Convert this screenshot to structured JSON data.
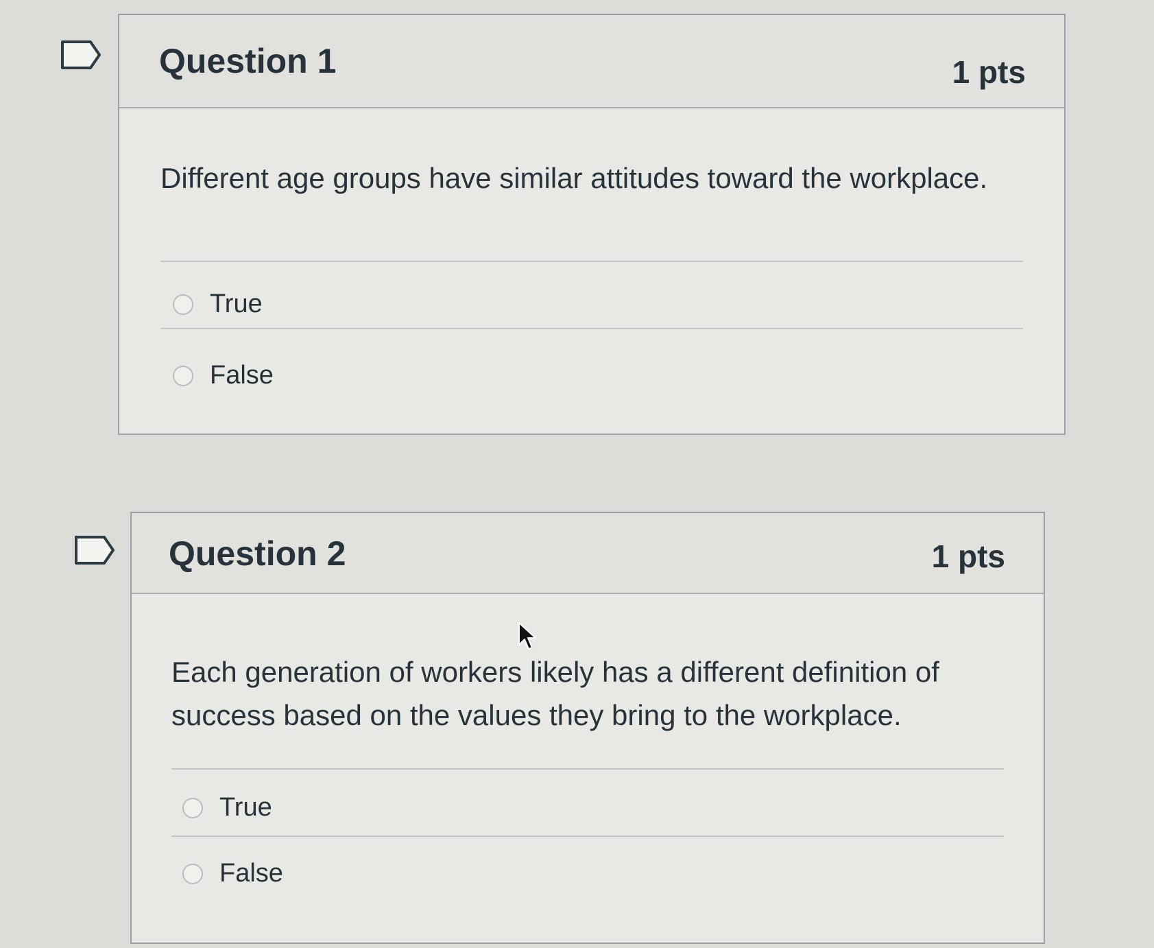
{
  "questions": [
    {
      "title": "Question 1",
      "points": "1 pts",
      "text": "Different age groups have similar attitudes toward the workplace.",
      "answers": [
        "True",
        "False"
      ]
    },
    {
      "title": "Question 2",
      "points": "1 pts",
      "text": "Each generation of workers likely has a different definition of success based on the values they bring to the workplace.",
      "answers": [
        "True",
        "False"
      ]
    }
  ],
  "icons": {
    "flag": "flag-question-icon",
    "cursor": "mouse-pointer-icon",
    "radio": "radio-button-icon"
  }
}
